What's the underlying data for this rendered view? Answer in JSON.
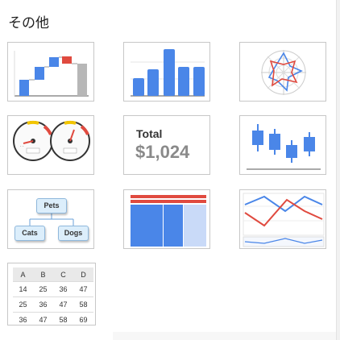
{
  "section": {
    "title": "その他"
  },
  "charts": {
    "waterfall": {
      "name": "Waterfall chart"
    },
    "column": {
      "name": "Column chart",
      "values": [
        0.33,
        0.49,
        0.86,
        0.53,
        0.53
      ]
    },
    "radar": {
      "name": "Radar chart"
    },
    "gauge": {
      "name": "Gauge chart"
    },
    "scorecard": {
      "label": "Total",
      "value": "$1,024"
    },
    "candlestick": {
      "name": "Candlestick chart"
    },
    "org": {
      "root": "Pets",
      "children": [
        "Cats",
        "Dogs"
      ]
    },
    "treemap": {
      "name": "Tree map chart"
    },
    "timeline": {
      "name": "Annotated timeline chart"
    },
    "table": {
      "headers": [
        "A",
        "B",
        "C",
        "D"
      ],
      "rows": [
        [
          "14",
          "25",
          "36",
          "47"
        ],
        [
          "25",
          "36",
          "47",
          "58"
        ],
        [
          "36",
          "47",
          "58",
          "69"
        ]
      ]
    }
  },
  "colors": {
    "blue": "#4a86e8",
    "red": "#e04a3f",
    "gray": "#b7b7b7",
    "lightblue": "#c9daf8"
  }
}
